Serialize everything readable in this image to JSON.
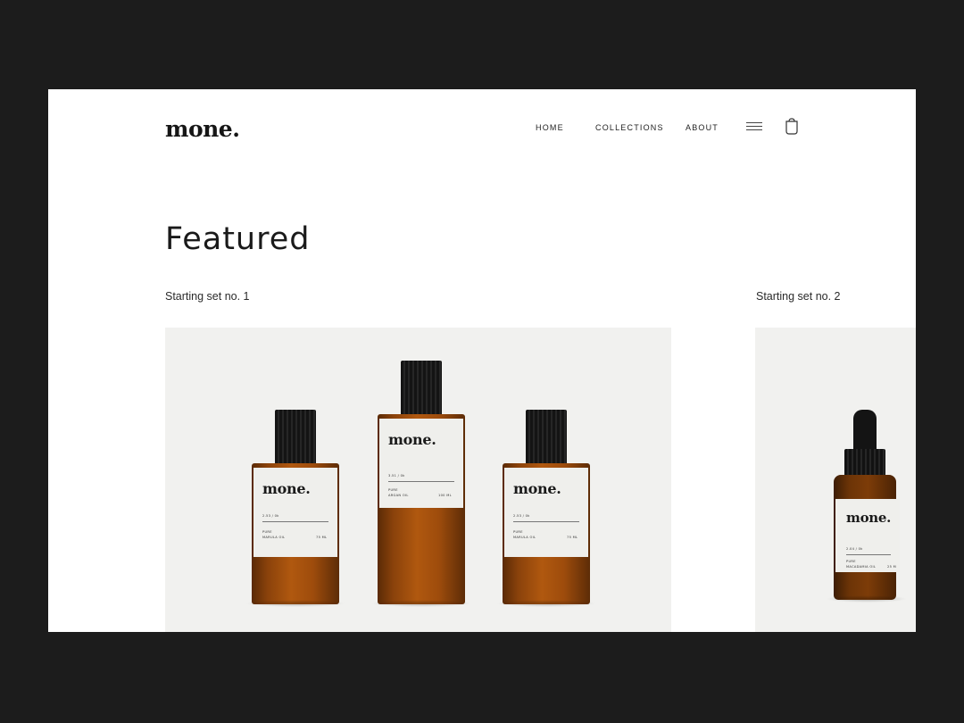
{
  "brand": {
    "logo": "mone."
  },
  "nav": {
    "items": [
      "HOME",
      "COLLECTIONS",
      "ABOUT"
    ]
  },
  "icons": {
    "menu": "hamburger-menu-icon",
    "cart": "shopping-bag-icon"
  },
  "main": {
    "title": "Featured",
    "sets": [
      {
        "label": "Starting set no. 1"
      },
      {
        "label": "Starting set no. 2"
      }
    ]
  },
  "products": {
    "set1": [
      {
        "brand": "mone.",
        "size": "2.53 / 0k",
        "line1": "PURE",
        "line2": "MARULA OIL",
        "volume": "75 ML"
      },
      {
        "brand": "mone.",
        "size": "3.51 / 0k",
        "line1": "PURE",
        "line2": "ARGAN OIL",
        "volume": "100 ML"
      },
      {
        "brand": "mone.",
        "size": "2.53 / 0k",
        "line1": "PURE",
        "line2": "MARULA OIL",
        "volume": "75 ML"
      }
    ],
    "set2": [
      {
        "brand": "mone.",
        "size": "2.04 / 0k",
        "line1": "PURE",
        "line2": "MACADAMIA OIL",
        "volume": "25 M"
      }
    ]
  },
  "colors": {
    "background": "#1c1c1c",
    "page": "#ffffff",
    "card": "#f1f1ef",
    "amber": "#9e4c0c"
  }
}
